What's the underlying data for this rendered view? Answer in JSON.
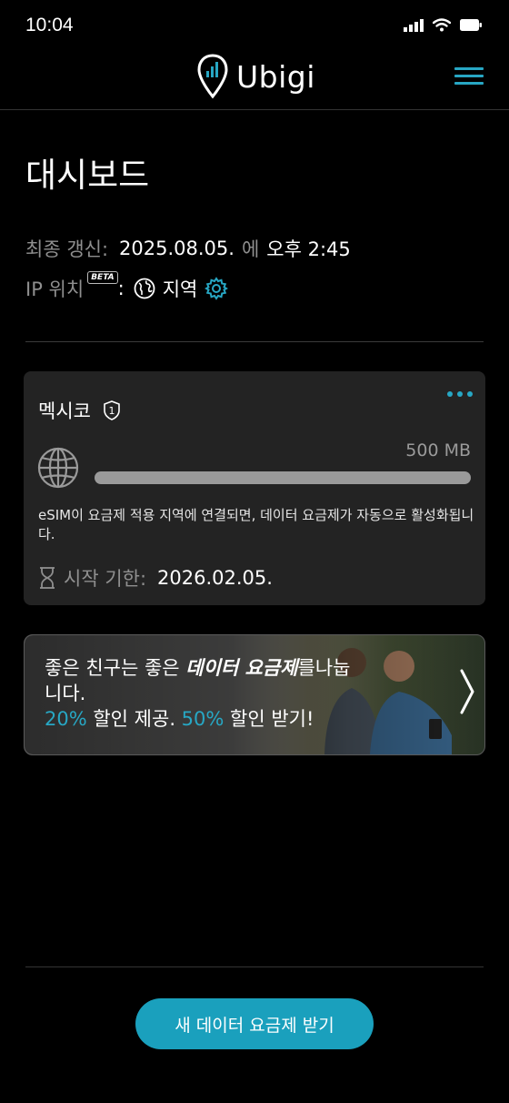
{
  "status_bar": {
    "time": "10:04"
  },
  "header": {
    "brand": "Ubigi"
  },
  "page": {
    "title": "대시보드"
  },
  "info": {
    "last_update_label": "최종 갱신:",
    "last_update_date": "2025.08.05.",
    "last_update_mid": "에",
    "last_update_time": "오후 2:45",
    "ip_label": "IP 위치",
    "beta": "BETA",
    "colon": ":",
    "ip_value": "지역"
  },
  "plan": {
    "country": "멕시코",
    "badge_number": "1",
    "data_amount": "500 MB",
    "usage_fraction": 1.0,
    "note": "eSIM이 요금제 적용 지역에 연결되면, 데이터 요금제가 자동으로 활성화됩니다.",
    "expiry_label": "시작 기한:",
    "expiry_value": "2026.02.05."
  },
  "promo": {
    "line1_a": "좋은 친구는 좋은 ",
    "line1_em": "데이터 요금제",
    "line1_b": "를나눕",
    "line2": "니다.",
    "pct1": "20%",
    "offer1": " 할인 제공. ",
    "pct2": "50%",
    "offer2": " 할인 받기!"
  },
  "cta": {
    "label": "새 데이터 요금제 받기"
  },
  "colors": {
    "accent": "#27a7c4",
    "cta": "#1aa0bd",
    "card": "#232323"
  }
}
